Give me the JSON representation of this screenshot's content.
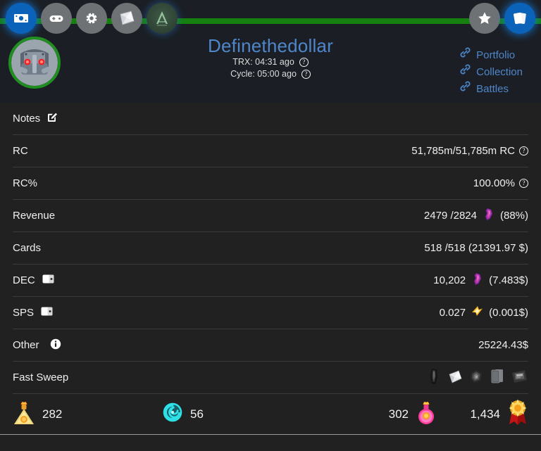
{
  "header": {
    "nav_left": [
      {
        "name": "money-icon",
        "label": "Money",
        "active": true
      },
      {
        "name": "gamepad-icon",
        "label": "Game",
        "active": false
      },
      {
        "name": "gear-icon",
        "label": "Settings",
        "active": false
      },
      {
        "name": "cards-pack-icon",
        "label": "Packs",
        "active": false
      },
      {
        "name": "archon-logo-icon",
        "label": "A",
        "active": false
      }
    ],
    "nav_right": [
      {
        "name": "star-icon",
        "label": "Favorites",
        "active": false
      },
      {
        "name": "deck-icon",
        "label": "Deck",
        "active": true
      }
    ],
    "avatar_name": "avatar",
    "title": "Definethedollar",
    "trx_label": "TRX:",
    "trx_value": "04:31 ago",
    "cycle_label": "Cycle:",
    "cycle_value": "05:00 ago",
    "links": [
      {
        "label": "Portfolio"
      },
      {
        "label": "Collection"
      },
      {
        "label": "Battles"
      }
    ],
    "accent_green": "#158010",
    "accent_blue": "#4e86c9"
  },
  "table": {
    "rows": [
      {
        "label": "Notes",
        "label_icon": "edit-icon",
        "value": "",
        "value_icon": "",
        "suffix": "",
        "help": false
      },
      {
        "label": "RC",
        "label_icon": "",
        "value": "51,785m/51,785m RC",
        "value_icon": "",
        "suffix": "",
        "help": true
      },
      {
        "label": "RC%",
        "label_icon": "",
        "value": "100.00%",
        "value_icon": "",
        "suffix": "",
        "help": true
      },
      {
        "label": "Revenue",
        "label_icon": "",
        "value": "2479 /2824",
        "value_icon": "dec-crystal-icon",
        "suffix": "(88%)",
        "help": false
      },
      {
        "label": "Cards",
        "label_icon": "",
        "value": "518 /518 (21391.97 $)",
        "value_icon": "",
        "suffix": "",
        "help": false
      },
      {
        "label": "DEC",
        "label_icon": "wallet-icon",
        "value": "10,202",
        "value_icon": "dec-crystal-icon",
        "suffix": "(7.483$)",
        "help": false
      },
      {
        "label": "SPS",
        "label_icon": "wallet-icon",
        "value": "0.027",
        "value_icon": "sps-bolt-icon",
        "suffix": "(0.001$)",
        "help": false
      },
      {
        "label": "Other",
        "label_icon": "info-icon",
        "value": "25224.43$",
        "value_icon": "",
        "suffix": "",
        "help": false
      }
    ],
    "fast_sweep": {
      "label": "Fast Sweep",
      "icons": [
        {
          "name": "sweep-item-1-icon"
        },
        {
          "name": "sweep-item-2-icon"
        },
        {
          "name": "sweep-item-3-icon"
        },
        {
          "name": "sweep-item-4-icon"
        },
        {
          "name": "sweep-item-5-icon"
        }
      ]
    }
  },
  "stats": [
    {
      "icon": "gold-potion-icon",
      "value": "282",
      "icon_first": true
    },
    {
      "icon": "teal-spiral-icon",
      "value": "56",
      "icon_first": true
    },
    {
      "icon": "pink-potion-icon",
      "value": "302",
      "icon_first": false
    },
    {
      "icon": "gold-medal-icon",
      "value": "1,434",
      "icon_first": false
    }
  ]
}
